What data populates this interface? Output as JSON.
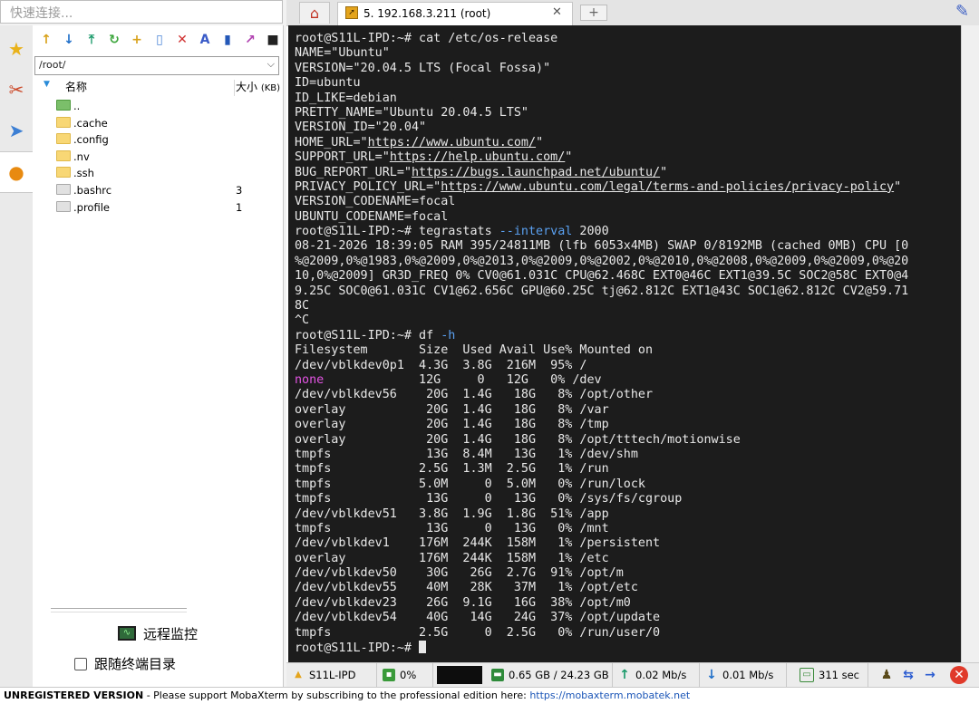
{
  "quick_connect": {
    "placeholder": "快速连接..."
  },
  "left_tabs": {
    "items": [
      {
        "icon": "star-icon",
        "glyph": "★",
        "color": "#e9b21a"
      },
      {
        "icon": "tools-icon",
        "glyph": "✂",
        "color": "#cc4a2a"
      },
      {
        "icon": "send-icon",
        "glyph": "➤",
        "color": "#3c7fd4"
      },
      {
        "icon": "sftp-globe-icon",
        "glyph": "●",
        "color": "#e88a10"
      }
    ]
  },
  "file_panel": {
    "toolbar": [
      {
        "icon": "upload-folder-icon",
        "glyph": "↑",
        "color": "#d8a21a"
      },
      {
        "icon": "download-icon",
        "glyph": "↓",
        "color": "#1f6fc9"
      },
      {
        "icon": "upload-icon",
        "glyph": "⤒",
        "color": "#1a9a6a"
      },
      {
        "icon": "refresh-icon",
        "glyph": "↻",
        "color": "#3aa53a"
      },
      {
        "icon": "new-folder-icon",
        "glyph": "+",
        "color": "#d8a21a"
      },
      {
        "icon": "new-file-icon",
        "glyph": "▯",
        "color": "#4f88d8"
      },
      {
        "icon": "delete-icon",
        "glyph": "✕",
        "color": "#d03030"
      },
      {
        "icon": "rename-icon",
        "glyph": "A",
        "color": "#3a5bc8"
      },
      {
        "icon": "permissions-icon",
        "glyph": "▮",
        "color": "#2458b8"
      },
      {
        "icon": "link-icon",
        "glyph": "↗",
        "color": "#b040b0"
      },
      {
        "icon": "terminal-icon",
        "glyph": "■",
        "color": "#222222"
      }
    ],
    "path": "/root/",
    "columns": {
      "name": "名称",
      "size_label": "大小",
      "size_unit": "(KB)"
    },
    "files": [
      {
        "name": "..",
        "type": "up",
        "size": ""
      },
      {
        "name": ".cache",
        "type": "folder",
        "size": ""
      },
      {
        "name": ".config",
        "type": "folder",
        "size": ""
      },
      {
        "name": ".nv",
        "type": "folder",
        "size": ""
      },
      {
        "name": ".ssh",
        "type": "folder",
        "size": ""
      },
      {
        "name": ".bashrc",
        "type": "file",
        "size": "3"
      },
      {
        "name": ".profile",
        "type": "file",
        "size": "1"
      }
    ],
    "remote_monitor_label": "远程监控",
    "follow_terminal_label": "跟随终端目录"
  },
  "tabs": {
    "session_title": "5. 192.168.3.211 (root)",
    "add_label": "+"
  },
  "terminal": {
    "prompt": "root@S11L-IPD:~#",
    "lines": [
      [
        {
          "t": "root@S11L-IPD:~# cat /etc/os-release"
        }
      ],
      [
        {
          "t": "NAME=\"Ubuntu\""
        }
      ],
      [
        {
          "t": "VERSION=\"20.04.5 LTS (Focal Fossa)\""
        }
      ],
      [
        {
          "t": "ID=ubuntu"
        }
      ],
      [
        {
          "t": "ID_LIKE=debian"
        }
      ],
      [
        {
          "t": "PRETTY_NAME=\"Ubuntu 20.04.5 LTS\""
        }
      ],
      [
        {
          "t": "VERSION_ID=\"20.04\""
        }
      ],
      [
        {
          "t": "HOME_URL=\""
        },
        {
          "t": "https://www.ubuntu.com/",
          "link": true
        },
        {
          "t": "\""
        }
      ],
      [
        {
          "t": "SUPPORT_URL=\""
        },
        {
          "t": "https://help.ubuntu.com/",
          "link": true
        },
        {
          "t": "\""
        }
      ],
      [
        {
          "t": "BUG_REPORT_URL=\""
        },
        {
          "t": "https://bugs.launchpad.net/ubuntu/",
          "link": true
        },
        {
          "t": "\""
        }
      ],
      [
        {
          "t": "PRIVACY_POLICY_URL=\""
        },
        {
          "t": "https://www.ubuntu.com/legal/terms-and-policies/privacy-policy",
          "link": true
        },
        {
          "t": "\""
        }
      ],
      [
        {
          "t": "VERSION_CODENAME=focal"
        }
      ],
      [
        {
          "t": "UBUNTU_CODENAME=focal"
        }
      ],
      [
        {
          "t": "root@S11L-IPD:~# tegrastats "
        },
        {
          "t": "--interval",
          "c": "blue"
        },
        {
          "t": " 2000"
        }
      ],
      [
        {
          "t": "08-21-2026 18:39:05 RAM 395/24811MB (lfb 6053x4MB) SWAP 0/8192MB (cached 0MB) CPU [0"
        }
      ],
      [
        {
          "t": "%@2009,0%@1983,0%@2009,0%@2013,0%@2009,0%@2002,0%@2010,0%@2008,0%@2009,0%@2009,0%@20"
        }
      ],
      [
        {
          "t": "10,0%@2009] GR3D_FREQ 0% CV0@61.031C CPU@62.468C EXT0@46C EXT1@39.5C SOC2@58C EXT0@4"
        }
      ],
      [
        {
          "t": "9.25C SOC0@61.031C CV1@62.656C GPU@60.25C tj@62.812C EXT1@43C SOC1@62.812C CV2@59.71"
        }
      ],
      [
        {
          "t": "8C"
        }
      ],
      [
        {
          "t": "^C"
        }
      ],
      [
        {
          "t": "root@S11L-IPD:~# df "
        },
        {
          "t": "-h",
          "c": "blue"
        }
      ],
      [
        {
          "t": "Filesystem       Size  Used Avail Use% Mounted on"
        }
      ],
      [
        {
          "t": "/dev/vblkdev0p1  4.3G  3.8G  216M  95% /"
        }
      ],
      [
        {
          "t": "none",
          "c": "magenta"
        },
        {
          "t": "             12G     0   12G   0% /dev"
        }
      ],
      [
        {
          "t": "/dev/vblkdev56    20G  1.4G   18G   8% /opt/other"
        }
      ],
      [
        {
          "t": "overlay           20G  1.4G   18G   8% /var"
        }
      ],
      [
        {
          "t": "overlay           20G  1.4G   18G   8% /tmp"
        }
      ],
      [
        {
          "t": "overlay           20G  1.4G   18G   8% /opt/tttech/motionwise"
        }
      ],
      [
        {
          "t": "tmpfs             13G  8.4M   13G   1% /dev/shm"
        }
      ],
      [
        {
          "t": "tmpfs            2.5G  1.3M  2.5G   1% /run"
        }
      ],
      [
        {
          "t": "tmpfs            5.0M     0  5.0M   0% /run/lock"
        }
      ],
      [
        {
          "t": "tmpfs             13G     0   13G   0% /sys/fs/cgroup"
        }
      ],
      [
        {
          "t": "/dev/vblkdev51   3.8G  1.9G  1.8G  51% /app"
        }
      ],
      [
        {
          "t": "tmpfs             13G     0   13G   0% /mnt"
        }
      ],
      [
        {
          "t": "/dev/vblkdev1    176M  244K  158M   1% /persistent"
        }
      ],
      [
        {
          "t": "overlay          176M  244K  158M   1% /etc"
        }
      ],
      [
        {
          "t": "/dev/vblkdev50    30G   26G  2.7G  91% /opt/m"
        }
      ],
      [
        {
          "t": "/dev/vblkdev55    40M   28K   37M   1% /opt/etc"
        }
      ],
      [
        {
          "t": "/dev/vblkdev23    26G  9.1G   16G  38% /opt/m0"
        }
      ],
      [
        {
          "t": "/dev/vblkdev54    40G   14G   24G  37% /opt/update"
        }
      ],
      [
        {
          "t": "tmpfs            2.5G     0  2.5G   0% /run/user/0"
        }
      ],
      [
        {
          "t": "root@S11L-IPD:~# "
        },
        {
          "cursor": true
        }
      ]
    ]
  },
  "status_bar": {
    "host": "S11L-IPD",
    "cpu": "0%",
    "memory": "0.65 GB / 24.23 GB",
    "upload": "0.02 Mb/s",
    "download": "0.01 Mb/s",
    "uptime": "311 sec"
  },
  "banner": {
    "title": "UNREGISTERED VERSION",
    "message": "  -  Please support MobaXterm by subscribing to the professional edition here: ",
    "link": "https://mobaxterm.mobatek.net"
  },
  "colors": {
    "terminal_bg": "#1c1c1c",
    "terminal_fg": "#e8e8e8",
    "option_blue": "#5aa0f0",
    "none_magenta": "#e354e3",
    "link_blue": "#1a55b7"
  }
}
